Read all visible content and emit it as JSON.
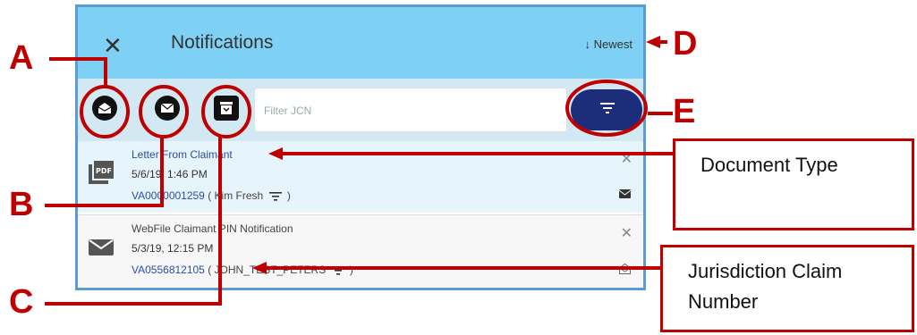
{
  "header": {
    "close_glyph": "✕",
    "title": "Notifications",
    "sort_label": "↓ Newest"
  },
  "toolbar": {
    "filter_placeholder": "Filter JCN"
  },
  "notifications": [
    {
      "title": "Letter From Claimant",
      "datetime": "5/6/19, 1:46 PM",
      "jcn": "VA0000001259",
      "claimant": "( Kim Fresh",
      "close_paren": ")",
      "icon": "pdf-icon",
      "status_icon": "envelope-closed-icon"
    },
    {
      "title": "WebFile Claimant PIN Notification",
      "datetime": "5/3/19, 12:15 PM",
      "jcn": "VA0556812105",
      "claimant": "( JOHN_TEST_PETERS",
      "close_paren": ")",
      "icon": "envelope-icon",
      "status_icon": "envelope-open-icon"
    }
  ],
  "annotations": {
    "letters": [
      "A",
      "B",
      "C",
      "D",
      "E"
    ],
    "document_type": "Document Type",
    "jurisdiction_claim_number": "Jurisdiction Claim Number",
    "color": "#c00000"
  },
  "colors": {
    "header_bg": "#7fd0f5",
    "toolbar_bg": "#d2e8f3",
    "filter_button": "#1c2e7a",
    "link": "#2a4ea8",
    "panel_border": "#5b9bd5"
  }
}
